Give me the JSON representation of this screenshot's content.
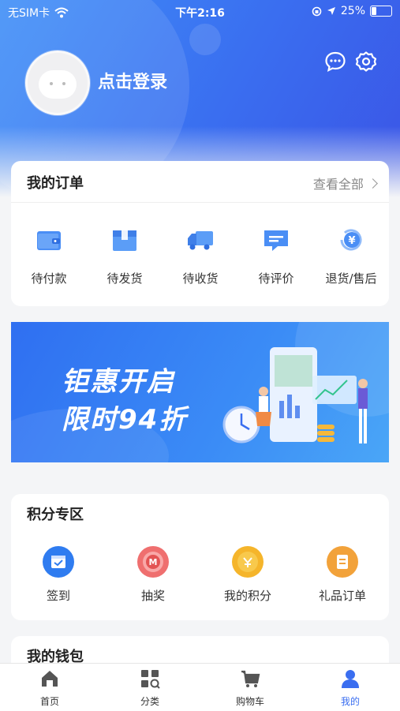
{
  "status_bar": {
    "carrier": "无SIM卡",
    "time": "下午2:16",
    "battery": "25%",
    "battery_level": 0.25
  },
  "header": {
    "login_text": "点击登录"
  },
  "orders": {
    "title": "我的订单",
    "view_all": "查看全部",
    "items": [
      {
        "label": "待付款",
        "icon": "wallet-icon"
      },
      {
        "label": "待发货",
        "icon": "package-icon"
      },
      {
        "label": "待收货",
        "icon": "truck-icon"
      },
      {
        "label": "待评价",
        "icon": "comment-icon"
      },
      {
        "label": "退货/售后",
        "icon": "refund-icon"
      }
    ]
  },
  "banner": {
    "line1": "钜惠开启",
    "line2": "限时94折"
  },
  "points": {
    "title": "积分专区",
    "items": [
      {
        "label": "签到",
        "icon": "calendar-check-icon",
        "color": "#2f7cf0"
      },
      {
        "label": "抽奖",
        "icon": "lottery-icon",
        "color": "#ef6f6f"
      },
      {
        "label": "我的积分",
        "icon": "points-coin-icon",
        "color": "#f5b52b"
      },
      {
        "label": "礼品订单",
        "icon": "gift-order-icon",
        "color": "#f2a23a"
      }
    ]
  },
  "wallet": {
    "title": "我的钱包"
  },
  "tabbar": {
    "items": [
      {
        "label": "首页",
        "icon": "home-icon"
      },
      {
        "label": "分类",
        "icon": "category-icon"
      },
      {
        "label": "购物车",
        "icon": "cart-icon"
      },
      {
        "label": "我的",
        "icon": "user-icon"
      }
    ],
    "active_color": "#3a6ef0"
  }
}
